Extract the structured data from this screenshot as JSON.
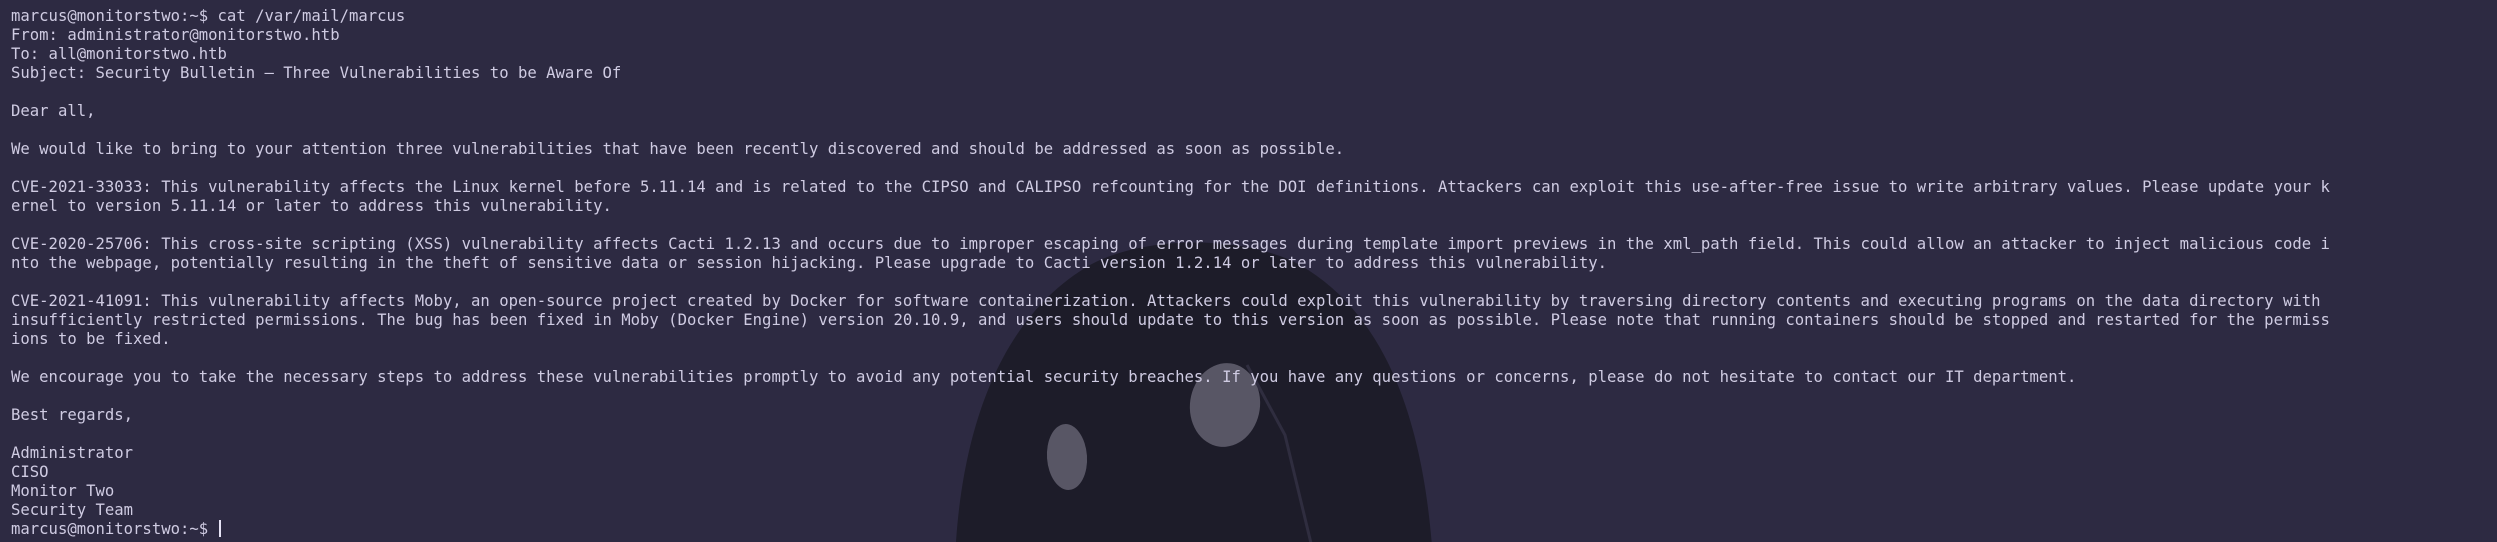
{
  "colors": {
    "background": "#2d2a42",
    "text": "#cfcbe2",
    "wallpaper_dark": "#1d1c29",
    "wallpaper_highlight": "#585665"
  },
  "wallpaper": {
    "icon": "hooded-figure-icon"
  },
  "session": {
    "prompt": "marcus@monitorstwo:~$",
    "command": "cat /var/mail/marcus",
    "final_prompt": "marcus@monitorstwo:~$"
  },
  "mail": {
    "from": "From: administrator@monitorstwo.htb",
    "to": "To: all@monitorstwo.htb",
    "subject": "Subject: Security Bulletin – Three Vulnerabilities to be Aware Of",
    "greeting": "Dear all,",
    "intro": "We would like to bring to your attention three vulnerabilities that have been recently discovered and should be addressed as soon as possible.",
    "vuln1_line1": "CVE-2021-33033: This vulnerability affects the Linux kernel before 5.11.14 and is related to the CIPSO and CALIPSO refcounting for the DOI definitions. Attackers can exploit this use-after-free issue to write arbitrary values. Please update your k",
    "vuln1_line2": "ernel to version 5.11.14 or later to address this vulnerability.",
    "vuln2_line1": "CVE-2020-25706: This cross-site scripting (XSS) vulnerability affects Cacti 1.2.13 and occurs due to improper escaping of error messages during template import previews in the xml_path field. This could allow an attacker to inject malicious code i",
    "vuln2_line2": "nto the webpage, potentially resulting in the theft of sensitive data or session hijacking. Please upgrade to Cacti version 1.2.14 or later to address this vulnerability.",
    "vuln3_line1": "CVE-2021-41091: This vulnerability affects Moby, an open-source project created by Docker for software containerization. Attackers could exploit this vulnerability by traversing directory contents and executing programs on the data directory with",
    "vuln3_line2": "insufficiently restricted permissions. The bug has been fixed in Moby (Docker Engine) version 20.10.9, and users should update to this version as soon as possible. Please note that running containers should be stopped and restarted for the permiss",
    "vuln3_line3": "ions to be fixed.",
    "closing": "We encourage you to take the necessary steps to address these vulnerabilities promptly to avoid any potential security breaches. If you have any questions or concerns, please do not hesitate to contact our IT department.",
    "regards": "Best regards,",
    "sig_name": "Administrator",
    "sig_title": "CISO",
    "sig_org": "Monitor Two",
    "sig_team": "Security Team"
  }
}
